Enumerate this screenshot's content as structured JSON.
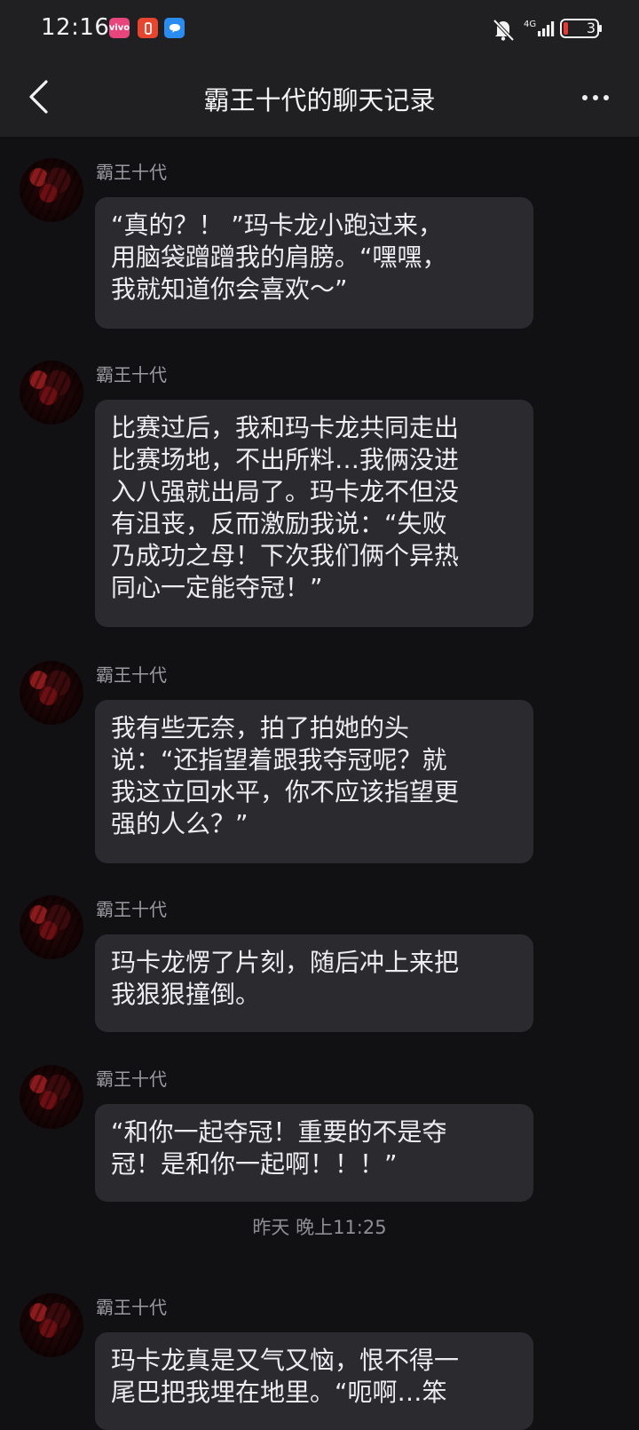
{
  "status_bar": {
    "time": "12:16",
    "network": "4G",
    "battery_level": "3",
    "notif_icons": [
      "vivo-app-icon",
      "red-app-icon",
      "messenger-icon"
    ]
  },
  "header": {
    "title": "霸王十代的聊天记录",
    "back_label": "<",
    "more_label": "..."
  },
  "colors": {
    "background": "#111113",
    "header": "#202023",
    "bubble": "#2b2b2f",
    "text": "#ededf0",
    "muted": "#9a9aa0"
  },
  "messages": [
    {
      "sender": "霸王十代",
      "text": "“真的？！ ”玛卡龙小跑过来，\n用脑袋蹭蹭我的肩膀。“嘿嘿，\n我就知道你会喜欢～”"
    },
    {
      "sender": "霸王十代",
      "text": "比赛过后，我和玛卡龙共同走出\n比赛场地，不出所料…我俩没进\n入八强就出局了。玛卡龙不但没\n有沮丧，反而激励我说：“失败\n乃成功之母！下次我们俩个异热\n同心一定能夺冠！”"
    },
    {
      "sender": "霸王十代",
      "text": "我有些无奈，拍了拍她的头\n说：“还指望着跟我夺冠呢？就\n我这立回水平，你不应该指望更\n强的人么？”"
    },
    {
      "sender": "霸王十代",
      "text": "玛卡龙愣了片刻，随后冲上来把\n我狠狠撞倒。"
    },
    {
      "sender": "霸王十代",
      "text": "“和你一起夺冠！重要的不是夺\n冠！是和你一起啊！！！”"
    },
    {
      "sender": "霸王十代",
      "text": "玛卡龙真是又气又恼，恨不得一\n尾巴把我埋在地里。“呃啊…笨"
    }
  ],
  "time_divider": "昨天 晚上11:25"
}
